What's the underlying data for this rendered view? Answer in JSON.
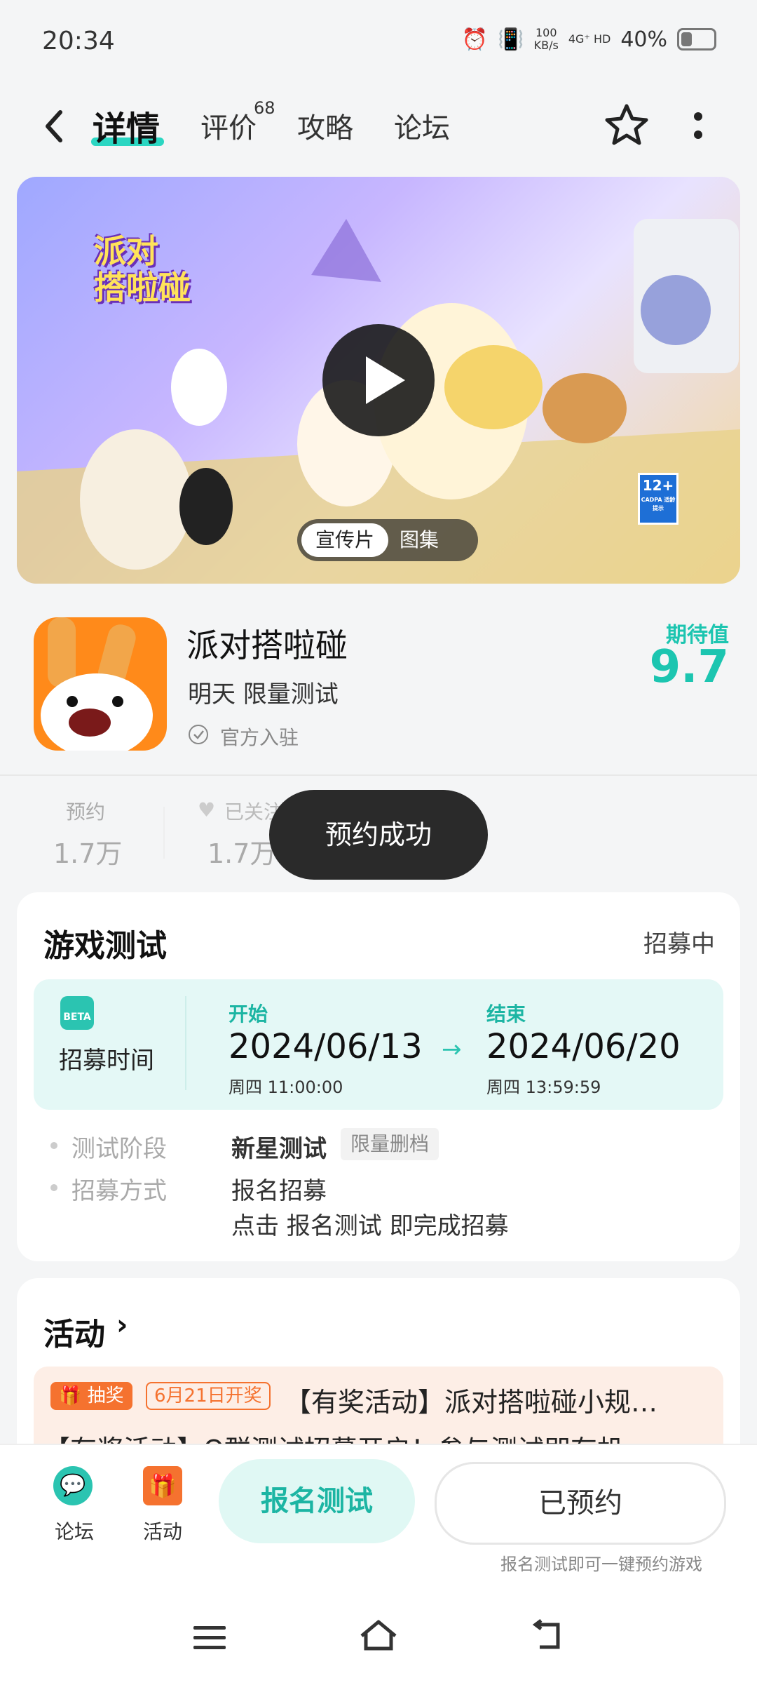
{
  "status_bar": {
    "time": "20:34",
    "net_speed_top": "100",
    "net_speed_bottom": "KB/s",
    "net_type": "4G⁺ HD",
    "battery": "40%",
    "battery_level": 0.4
  },
  "header": {
    "tabs": [
      {
        "label": "详情"
      },
      {
        "label": "评价"
      },
      {
        "label": "攻略"
      },
      {
        "label": "论坛"
      }
    ],
    "review_count": "68"
  },
  "banner": {
    "logo_line1": "派对",
    "logo_line2": "搭啦碰",
    "age_rating": "12+",
    "age_note": "CADPA 适龄提示",
    "media_promo": "宣传片",
    "media_gallery": "图集"
  },
  "game": {
    "title": "派对搭啦碰",
    "status": "明天 限量测试",
    "official": "官方入驻",
    "expect_label": "期待值",
    "expect_value": "9.7"
  },
  "stats": {
    "reservations_label": "预约",
    "reservations_value": "1.7万",
    "follow_label": "已关注",
    "follow_value": "1.7万"
  },
  "toast": "预约成功",
  "test": {
    "title": "游戏测试",
    "status": "招募中",
    "beta_label": "BETA",
    "recruit_time_label": "招募时间",
    "start_label": "开始",
    "start_date": "2024/06/13",
    "start_time": "周四  11:00:00",
    "end_label": "结束",
    "end_date": "2024/06/20",
    "end_time": "周四  13:59:59",
    "phase_label": "测试阶段",
    "phase_value": "新星测试",
    "phase_tag": "限量删档",
    "method_label": "招募方式",
    "method_value": "报名招募",
    "method_desc": "点击 报名测试 即完成招募"
  },
  "activity": {
    "title": "活动",
    "lottery_tag": "抽奖",
    "date_tag": "6月21日开奖",
    "item_text": "【有奖活动】派对搭啦碰小规…",
    "item_text2": "【有奖活动】Q群测试招募开启！参与测试即有机"
  },
  "bottom": {
    "forum_label": "论坛",
    "activity_label": "活动",
    "signup_button": "报名测试",
    "reserved_button": "已预约",
    "hint": "报名测试即可一键预约游戏"
  },
  "colors": {
    "accent": "#1cc5b0",
    "orange": "#f5722f"
  }
}
